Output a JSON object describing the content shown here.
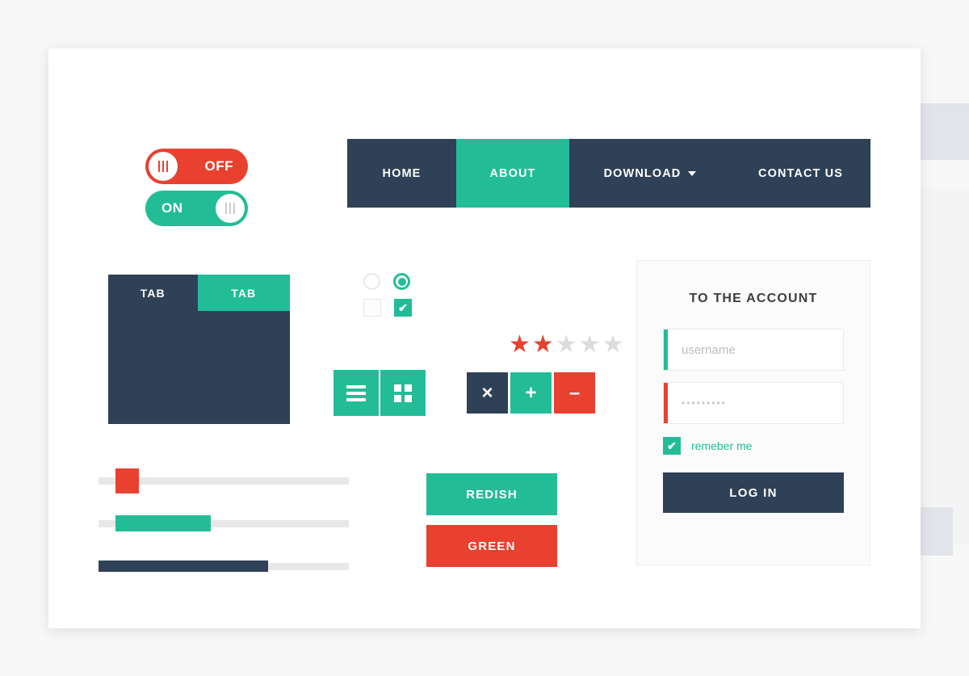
{
  "theme": {
    "green": "#22bd97",
    "red": "#e8412f",
    "navy": "#2f4156",
    "sheet_bg": "#ffffff",
    "page_bg": "#f7f7f7",
    "track_gray": "#e8e8e8"
  },
  "toggles": [
    {
      "label": "OFF",
      "state": "off",
      "color": "#e8412f",
      "knob_icon": "three-bars-icon"
    },
    {
      "label": "ON",
      "state": "on",
      "color": "#22bd97",
      "knob_icon": "three-bars-icon"
    }
  ],
  "navbar": {
    "items": [
      {
        "label": "HOME",
        "active": false,
        "has_caret": false
      },
      {
        "label": "ABOUT",
        "active": true,
        "has_caret": false
      },
      {
        "label": "DOWNLOAD",
        "active": false,
        "has_caret": true
      },
      {
        "label": "CONTACT US",
        "active": false,
        "has_caret": false
      }
    ]
  },
  "tabs": {
    "items": [
      {
        "label": "TAB",
        "active": false
      },
      {
        "label": "TAB",
        "active": true
      }
    ]
  },
  "choices": {
    "radio_unselected": "radio-unchecked-icon",
    "radio_selected": "radio-checked-icon",
    "checkbox_unchecked": "checkbox-empty-icon",
    "checkbox_checked": "checkbox-checked-icon",
    "check_glyph": "✔"
  },
  "rating": {
    "filled": 2,
    "total": 5,
    "glyph": "★",
    "filled_color": "#e8412f",
    "empty_color": "#dcdcdc"
  },
  "icon_buttons_primary": [
    {
      "name": "list-view-button",
      "icon": "hamburger-icon",
      "color": "#22bd97"
    },
    {
      "name": "grid-view-button",
      "icon": "grid-icon",
      "color": "#22bd97"
    }
  ],
  "icon_buttons_secondary": [
    {
      "name": "close-button",
      "glyph": "×",
      "icon": "close-icon",
      "color": "#2f4156"
    },
    {
      "name": "add-button",
      "glyph": "+",
      "icon": "plus-icon",
      "color": "#22bd97"
    },
    {
      "name": "remove-button",
      "glyph": "–",
      "icon": "minus-icon",
      "color": "#e8412f"
    }
  ],
  "sliders": [
    {
      "name": "slider-red",
      "value_percent": 7,
      "handle_color": "#e8412f",
      "style": "handle"
    },
    {
      "name": "slider-green",
      "value_percent": 38,
      "fill_color": "#22bd97",
      "style": "range"
    },
    {
      "name": "progress-navy",
      "value_percent": 67,
      "fill_color": "#2f4156",
      "style": "progress"
    }
  ],
  "wide_buttons": [
    {
      "label": "REDISH",
      "color": "#22bd97"
    },
    {
      "label": "GREEN",
      "color": "#e8412f"
    }
  ],
  "login": {
    "title": "TO THE ACCOUNT",
    "username_placeholder": "username",
    "username_value": "",
    "password_value": "•••••••••",
    "remember_label": "remeber me",
    "remember_checked": true,
    "check_glyph": "✔",
    "submit_label": "LOG IN"
  }
}
